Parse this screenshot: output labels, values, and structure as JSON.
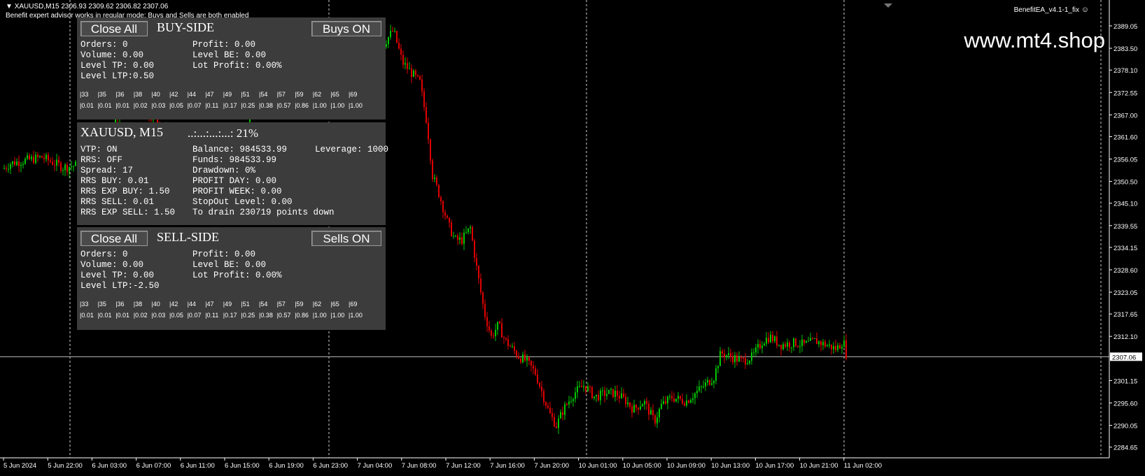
{
  "header": {
    "symbol_line": "XAUUSD,M15  2306.93 2309.62 2306.82 2307.06",
    "mode_line": "Benefit expert advisor works in regular mode: Buys and Sells are both enabled",
    "ea_name": "BenefitEA_v4.1-1_fix",
    "watermark": "www.mt4.shop"
  },
  "buy_panel": {
    "close_all_label": "Close All",
    "title": "BUY-SIDE",
    "toggle_label": "Buys ON",
    "left_lines": [
      "Orders: 0",
      "Volume: 0.00",
      "Level TP: 0.00",
      "Level LTP:0.50"
    ],
    "right_lines": [
      "Profit: 0.00",
      "Level BE: 0.00",
      "Lot Profit: 0.00%"
    ],
    "levels": [
      "|33",
      "|35",
      "|36",
      "|38",
      "|40",
      "|42",
      "|44",
      "|47",
      "|49",
      "|51",
      "|54",
      "|57",
      "|59",
      "|62",
      "|65",
      "|69"
    ],
    "lots": [
      "|0.01",
      "|0.01",
      "|0.01",
      "|0.02",
      "|0.03",
      "|0.05",
      "|0.07",
      "|0.11",
      "|0.17",
      "|0.25",
      "|0.38",
      "|0.57",
      "|0.86",
      "|1.00",
      "|1.00",
      "|1.00"
    ]
  },
  "info_panel": {
    "pair_title": "XAUUSD, M15",
    "progress_text": "..:...:...:...: 21%",
    "col1": [
      "VTP: ON",
      "RRS: OFF",
      "Spread: 17",
      "RRS BUY: 0.01",
      "RRS EXP BUY: 1.50",
      "RRS SELL: 0.01",
      "RRS EXP SELL: 1.50"
    ],
    "col2": [
      "Balance: 984533.99",
      "Funds: 984533.99",
      "Drawdown: 0%",
      "PROFIT DAY: 0.00",
      "PROFIT WEEK: 0.00",
      "StopOut Level: 0.00",
      "To drain 230719 points down"
    ],
    "leverage": "Leverage: 1000"
  },
  "sell_panel": {
    "close_all_label": "Close All",
    "title": "SELL-SIDE",
    "toggle_label": "Sells ON",
    "left_lines": [
      "Orders: 0",
      "Volume: 0.00",
      "Level TP: 0.00",
      "Level LTP:-2.50"
    ],
    "right_lines": [
      "Profit: 0.00",
      "Level BE: 0.00",
      "Lot Profit: 0.00%"
    ],
    "levels": [
      "|33",
      "|35",
      "|36",
      "|38",
      "|40",
      "|42",
      "|44",
      "|47",
      "|49",
      "|51",
      "|54",
      "|57",
      "|59",
      "|62",
      "|65",
      "|69"
    ],
    "lots": [
      "|0.01",
      "|0.01",
      "|0.01",
      "|0.02",
      "|0.03",
      "|0.05",
      "|0.07",
      "|0.11",
      "|0.17",
      "|0.25",
      "|0.38",
      "|0.57",
      "|0.86",
      "|1.00",
      "|1.00",
      "|1.00"
    ]
  },
  "chart_data": {
    "type": "candlestick",
    "symbol": "XAUUSD",
    "timeframe": "M15",
    "current_price": 2307.06,
    "ylim": [
      2282.0,
      2392.0
    ],
    "y_ticks": [
      "2389.05",
      "2383.50",
      "2378.10",
      "2372.55",
      "2367.00",
      "2361.60",
      "2356.05",
      "2350.50",
      "2345.10",
      "2339.55",
      "2334.15",
      "2328.60",
      "2323.05",
      "2317.65",
      "2312.10",
      "2301.15",
      "2295.60",
      "2290.05",
      "2284.65"
    ],
    "x_labels": [
      "5 Jun 2024",
      "5 Jun 22:00",
      "6 Jun 03:00",
      "6 Jun 07:00",
      "6 Jun 11:00",
      "6 Jun 15:00",
      "6 Jun 19:00",
      "6 Jun 23:00",
      "7 Jun 04:00",
      "7 Jun 08:00",
      "7 Jun 12:00",
      "7 Jun 16:00",
      "7 Jun 20:00",
      "10 Jun 01:00",
      "10 Jun 05:00",
      "10 Jun 09:00",
      "10 Jun 13:00",
      "10 Jun 17:00",
      "10 Jun 21:00",
      "11 Jun 02:00"
    ],
    "path_points": [
      [
        0,
        2353
      ],
      [
        15,
        2355
      ],
      [
        60,
        2356.5
      ],
      [
        90,
        2354
      ],
      [
        110,
        2354.5
      ],
      [
        135,
        2356
      ],
      [
        150,
        2359
      ],
      [
        165,
        2366
      ],
      [
        180,
        2371
      ],
      [
        195,
        2368
      ],
      [
        215,
        2366.5
      ],
      [
        245,
        2363
      ],
      [
        270,
        2361
      ],
      [
        305,
        2360
      ],
      [
        330,
        2359
      ],
      [
        350,
        2361
      ],
      [
        370,
        2372
      ],
      [
        400,
        2374
      ],
      [
        430,
        2375
      ],
      [
        450,
        2376
      ],
      [
        470,
        2377
      ],
      [
        500,
        2378
      ],
      [
        515,
        2373
      ],
      [
        535,
        2380
      ],
      [
        550,
        2385
      ],
      [
        562,
        2388
      ],
      [
        575,
        2380
      ],
      [
        590,
        2377
      ],
      [
        600,
        2375
      ],
      [
        610,
        2365
      ],
      [
        618,
        2352
      ],
      [
        628,
        2347
      ],
      [
        640,
        2340
      ],
      [
        650,
        2336
      ],
      [
        660,
        2336
      ],
      [
        672,
        2339
      ],
      [
        682,
        2328
      ],
      [
        692,
        2318
      ],
      [
        702,
        2312
      ],
      [
        712,
        2315
      ],
      [
        722,
        2311
      ],
      [
        742,
        2307
      ],
      [
        752,
        2306
      ],
      [
        765,
        2303
      ],
      [
        775,
        2298
      ],
      [
        785,
        2293
      ],
      [
        795,
        2290
      ],
      [
        805,
        2294
      ],
      [
        820,
        2298
      ],
      [
        835,
        2300
      ],
      [
        850,
        2297
      ],
      [
        865,
        2298
      ],
      [
        880,
        2298
      ],
      [
        895,
        2296
      ],
      [
        905,
        2294
      ],
      [
        920,
        2296
      ],
      [
        935,
        2291
      ],
      [
        945,
        2295
      ],
      [
        960,
        2297
      ],
      [
        980,
        2296
      ],
      [
        1000,
        2299
      ],
      [
        1020,
        2302
      ],
      [
        1030,
        2308
      ],
      [
        1045,
        2307
      ],
      [
        1060,
        2306
      ],
      [
        1075,
        2307
      ],
      [
        1090,
        2311
      ],
      [
        1100,
        2312
      ],
      [
        1115,
        2310
      ],
      [
        1135,
        2310.5
      ],
      [
        1150,
        2310
      ],
      [
        1165,
        2311
      ],
      [
        1180,
        2310
      ],
      [
        1195,
        2309
      ],
      [
        1205,
        2311
      ],
      [
        1210,
        2307
      ]
    ]
  }
}
